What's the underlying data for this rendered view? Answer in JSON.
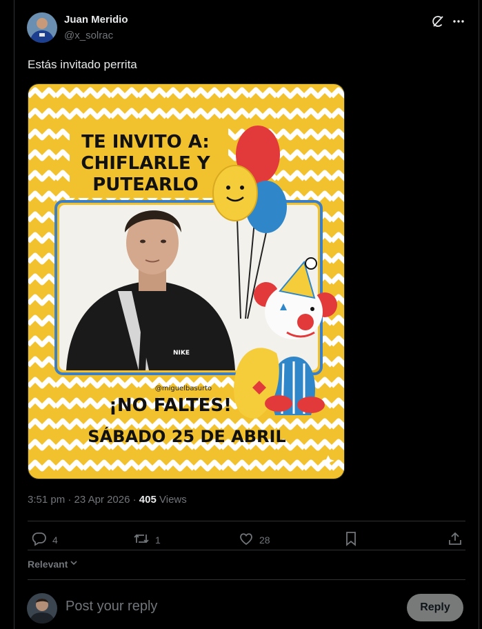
{
  "author": {
    "name": "Juan Meridio",
    "handle": "@x_solrac"
  },
  "tweet": {
    "text": "Estás invitado perrita"
  },
  "flyer": {
    "headline1": "TE INVITO A:",
    "headline2": "CHIFLARLE Y",
    "headline3": "PUTEARLO",
    "watermark": "@miguelbasurto",
    "cta": "¡NO FALTES!",
    "date": "SÁBADO 25 DE ABRIL",
    "shirt_logo": "NIKE"
  },
  "meta": {
    "time": "3:51 pm",
    "date": "23 Apr 2026",
    "sep": "·",
    "views_count": "405",
    "views_label": "Views"
  },
  "actions": {
    "replies": "4",
    "reposts": "1",
    "likes": "28"
  },
  "sort": {
    "label": "Relevant"
  },
  "reply": {
    "placeholder": "Post your reply",
    "button": "Reply"
  },
  "colors": {
    "background": "#000000",
    "flyer_yellow": "#f2c12e",
    "frame_blue": "#3d7fc1",
    "balloon_red": "#e23a3a",
    "balloon_blue": "#2f86c8"
  },
  "icons": [
    "grok-icon",
    "more-icon",
    "reply-icon",
    "repost-icon",
    "like-icon",
    "bookmark-icon",
    "share-icon",
    "chevron-down-icon"
  ]
}
